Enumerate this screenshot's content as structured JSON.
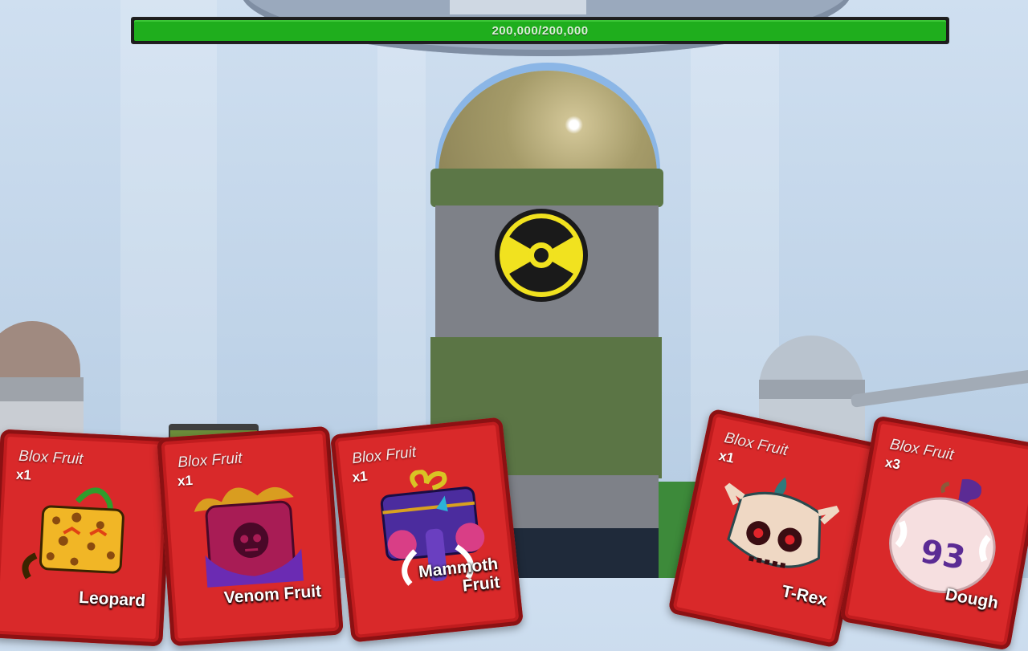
{
  "boss_health": {
    "text": "200,000/200,000",
    "current": 200000,
    "max": 200000,
    "fraction": 1.0,
    "color": "#1fae1d"
  },
  "scene": {
    "hazard_symbol": "radiation-icon"
  },
  "cards": [
    {
      "brand": "Blox Fruit",
      "count": "x1",
      "name": "Leopard",
      "icon": "leopard-fruit-icon"
    },
    {
      "brand": "Blox Fruit",
      "count": "x1",
      "name": "Venom Fruit",
      "icon": "venom-fruit-icon"
    },
    {
      "brand": "Blox Fruit",
      "count": "x1",
      "name": "Mammoth Fruit",
      "icon": "mammoth-fruit-icon"
    },
    {
      "brand": "Blox Fruit",
      "count": "x1",
      "name": "T-Rex",
      "icon": "trex-fruit-icon"
    },
    {
      "brand": "Blox Fruit",
      "count": "x3",
      "name": "Dough",
      "icon": "dough-fruit-icon"
    }
  ],
  "colors": {
    "card_red": "#d9292a",
    "card_border": "#8c1113"
  }
}
